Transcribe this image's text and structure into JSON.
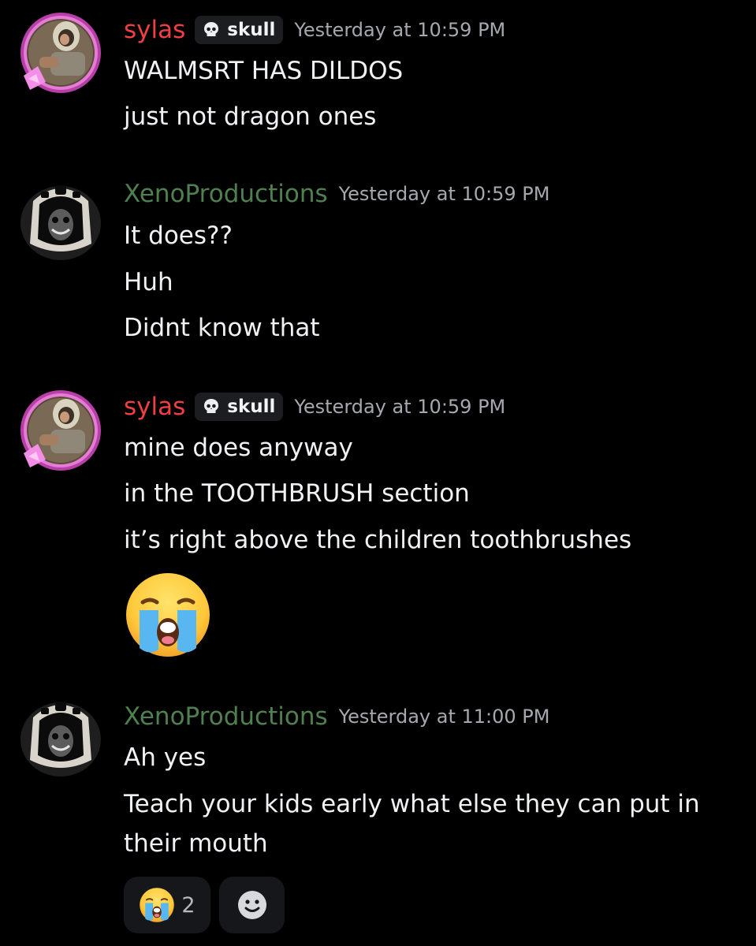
{
  "messages": [
    {
      "author": "sylas",
      "role_tag": "skull",
      "timestamp": "Yesterday at 10:59 PM",
      "lines": [
        "WALMSRT HAS DILDOS",
        "just not dragon ones"
      ]
    },
    {
      "author": "XenoProductions",
      "timestamp": "Yesterday at 10:59 PM",
      "lines": [
        "It does??",
        "Huh",
        "Didnt know that"
      ]
    },
    {
      "author": "sylas",
      "role_tag": "skull",
      "timestamp": "Yesterday at 10:59 PM",
      "lines": [
        "mine does anyway",
        "in the TOOTHBRUSH section",
        "it’s right above the children toothbrushes"
      ],
      "emoji": "loudly-crying-face"
    },
    {
      "author": "XenoProductions",
      "timestamp": "Yesterday at 11:00 PM",
      "lines": [
        "Ah yes",
        "Teach your kids early what else they can put in their mouth"
      ]
    }
  ],
  "reactions": [
    {
      "emoji": "loudly-crying-face",
      "count": "2"
    },
    {
      "emoji": "add-reaction-icon"
    }
  ],
  "colors": {
    "background": "#000000",
    "sylas_name": "#f23f43",
    "xeno_name": "#4f8050",
    "timestamp": "#a6a8b0",
    "message_text": "#f0f1f3",
    "tag_background": "#1c1d21",
    "reaction_background": "#16171b"
  }
}
